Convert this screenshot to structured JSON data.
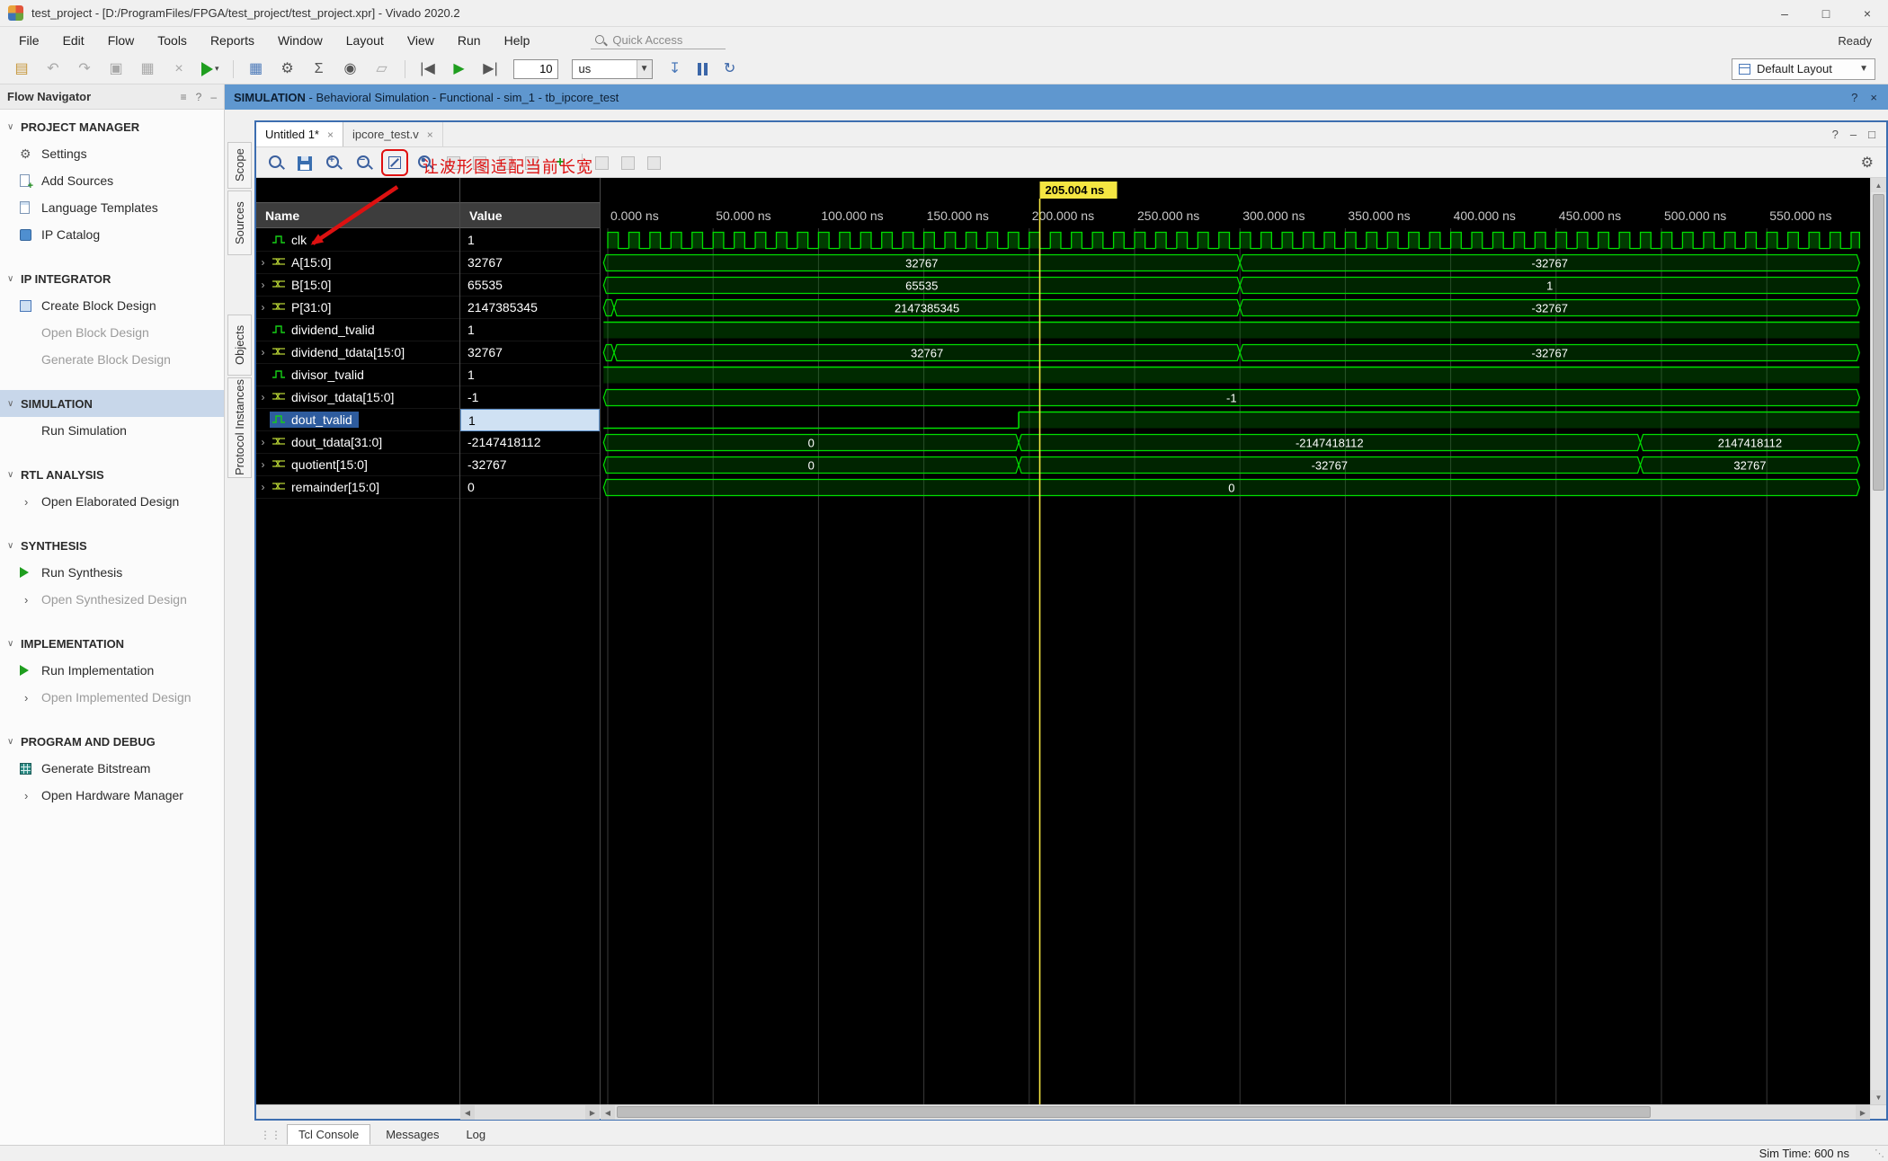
{
  "window": {
    "title": "test_project - [D:/ProgramFiles/FPGA/test_project/test_project.xpr] - Vivado 2020.2",
    "controls": {
      "minimize": "–",
      "maximize": "□",
      "close": "×"
    }
  },
  "menu": {
    "items": [
      "File",
      "Edit",
      "Flow",
      "Tools",
      "Reports",
      "Window",
      "Layout",
      "View",
      "Run",
      "Help"
    ],
    "quick_access": "Quick Access",
    "ready": "Ready"
  },
  "toolbar": {
    "time_value": "10",
    "time_unit": "us",
    "layout_label": "Default Layout"
  },
  "context_bar": {
    "title": "SIMULATION",
    "subtitle": " - Behavioral Simulation - Functional - sim_1 - tb_ipcore_test"
  },
  "flow_navigator": {
    "title": "Flow Navigator",
    "sections": [
      {
        "label": "PROJECT MANAGER",
        "selected": false,
        "items": [
          {
            "label": "Settings",
            "icon": "gear",
            "enabled": true,
            "chevron": false
          },
          {
            "label": "Add Sources",
            "icon": "docplus",
            "enabled": true,
            "chevron": false
          },
          {
            "label": "Language Templates",
            "icon": "doc",
            "enabled": true,
            "chevron": false
          },
          {
            "label": "IP Catalog",
            "icon": "ip",
            "enabled": true,
            "chevron": false
          }
        ]
      },
      {
        "label": "IP INTEGRATOR",
        "selected": false,
        "items": [
          {
            "label": "Create Block Design",
            "icon": "block",
            "enabled": true,
            "chevron": false
          },
          {
            "label": "Open Block Design",
            "icon": "none",
            "enabled": false,
            "chevron": false
          },
          {
            "label": "Generate Block Design",
            "icon": "none",
            "enabled": false,
            "chevron": false
          }
        ]
      },
      {
        "label": "SIMULATION",
        "selected": true,
        "items": [
          {
            "label": "Run Simulation",
            "icon": "none",
            "enabled": true,
            "chevron": false
          }
        ]
      },
      {
        "label": "RTL ANALYSIS",
        "selected": false,
        "items": [
          {
            "label": "Open Elaborated Design",
            "icon": "none",
            "enabled": true,
            "chevron": true
          }
        ]
      },
      {
        "label": "SYNTHESIS",
        "selected": false,
        "items": [
          {
            "label": "Run Synthesis",
            "icon": "play",
            "enabled": true,
            "chevron": false
          },
          {
            "label": "Open Synthesized Design",
            "icon": "none",
            "enabled": false,
            "chevron": true
          }
        ]
      },
      {
        "label": "IMPLEMENTATION",
        "selected": false,
        "items": [
          {
            "label": "Run Implementation",
            "icon": "play",
            "enabled": true,
            "chevron": false
          },
          {
            "label": "Open Implemented Design",
            "icon": "none",
            "enabled": false,
            "chevron": true
          }
        ]
      },
      {
        "label": "PROGRAM AND DEBUG",
        "selected": false,
        "items": [
          {
            "label": "Generate Bitstream",
            "icon": "bitstream",
            "enabled": true,
            "chevron": false
          },
          {
            "label": "Open Hardware Manager",
            "icon": "none",
            "enabled": true,
            "chevron": true
          }
        ]
      }
    ]
  },
  "side_tabs": [
    {
      "label": "Scope"
    },
    {
      "label": "Sources"
    },
    {
      "label": "Objects"
    },
    {
      "label": "Protocol Instances"
    }
  ],
  "wave_panel": {
    "tabs": [
      {
        "label": "Untitled 1*",
        "active": true
      },
      {
        "label": "ipcore_test.v",
        "active": false
      }
    ],
    "annotation_text": "让波形图适配当前长宽",
    "columns": {
      "name": "Name",
      "value": "Value"
    },
    "cursor": {
      "t": 205.004,
      "label": "205.004 ns"
    },
    "t_end": 594,
    "timeline": [
      {
        "t": 0,
        "label": "0.000 ns"
      },
      {
        "t": 50,
        "label": "50.000 ns"
      },
      {
        "t": 100,
        "label": "100.000 ns"
      },
      {
        "t": 150,
        "label": "150.000 ns"
      },
      {
        "t": 200,
        "label": "200.000 ns"
      },
      {
        "t": 250,
        "label": "250.000 ns"
      },
      {
        "t": 300,
        "label": "300.000 ns"
      },
      {
        "t": 350,
        "label": "350.000 ns"
      },
      {
        "t": 400,
        "label": "400.000 ns"
      },
      {
        "t": 450,
        "label": "450.000 ns"
      },
      {
        "t": 500,
        "label": "500.000 ns"
      },
      {
        "t": 550,
        "label": "550.000 ns"
      }
    ],
    "signals": [
      {
        "name": "clk",
        "value": "1",
        "kind": "clock",
        "period": 10
      },
      {
        "name": "A[15:0]",
        "value": "32767",
        "kind": "bus",
        "segs": [
          {
            "t0": -2,
            "t1": 300,
            "label": "32767"
          },
          {
            "t0": 300,
            "t1": 594,
            "label": "-32767"
          }
        ]
      },
      {
        "name": "B[15:0]",
        "value": "65535",
        "kind": "bus",
        "segs": [
          {
            "t0": -2,
            "t1": 300,
            "label": "65535"
          },
          {
            "t0": 300,
            "t1": 594,
            "label": "1"
          }
        ]
      },
      {
        "name": "P[31:0]",
        "value": "2147385345",
        "kind": "bus",
        "segs": [
          {
            "t0": -2,
            "t1": 3,
            "label": ""
          },
          {
            "t0": 3,
            "t1": 300,
            "label": "2147385345"
          },
          {
            "t0": 300,
            "t1": 594,
            "label": "-32767"
          }
        ]
      },
      {
        "name": "dividend_tvalid",
        "value": "1",
        "kind": "bit",
        "segs": [
          {
            "t0": -2,
            "t1": 594,
            "level": 1
          }
        ]
      },
      {
        "name": "dividend_tdata[15:0]",
        "value": "32767",
        "kind": "bus",
        "segs": [
          {
            "t0": -2,
            "t1": 3,
            "label": ""
          },
          {
            "t0": 3,
            "t1": 300,
            "label": "32767"
          },
          {
            "t0": 300,
            "t1": 594,
            "label": "-32767"
          }
        ]
      },
      {
        "name": "divisor_tvalid",
        "value": "1",
        "kind": "bit",
        "segs": [
          {
            "t0": -2,
            "t1": 594,
            "level": 1
          }
        ]
      },
      {
        "name": "divisor_tdata[15:0]",
        "value": "-1",
        "kind": "bus",
        "segs": [
          {
            "t0": -2,
            "t1": 594,
            "label": "-1"
          }
        ]
      },
      {
        "name": "dout_tvalid",
        "value": "1",
        "kind": "bit",
        "selected": true,
        "segs": [
          {
            "t0": -2,
            "t1": 195,
            "level": 0
          },
          {
            "t0": 195,
            "t1": 594,
            "level": 1
          }
        ]
      },
      {
        "name": "dout_tdata[31:0]",
        "value": "-2147418112",
        "kind": "bus",
        "segs": [
          {
            "t0": -2,
            "t1": 195,
            "label": "0"
          },
          {
            "t0": 195,
            "t1": 490,
            "label": "-2147418112"
          },
          {
            "t0": 490,
            "t1": 594,
            "label": "2147418112"
          }
        ]
      },
      {
        "name": "quotient[15:0]",
        "value": "-32767",
        "kind": "bus",
        "segs": [
          {
            "t0": -2,
            "t1": 195,
            "label": "0"
          },
          {
            "t0": 195,
            "t1": 490,
            "label": "-32767"
          },
          {
            "t0": 490,
            "t1": 594,
            "label": "32767"
          }
        ]
      },
      {
        "name": "remainder[15:0]",
        "value": "0",
        "kind": "bus",
        "segs": [
          {
            "t0": -2,
            "t1": 594,
            "label": "0"
          }
        ]
      }
    ]
  },
  "bottom_tabs": [
    {
      "label": "Tcl Console",
      "active": true
    },
    {
      "label": "Messages",
      "active": false
    },
    {
      "label": "Log",
      "active": false
    }
  ],
  "status_bar": {
    "sim_time": "Sim Time: 600 ns"
  },
  "colors": {
    "wave_green": "#00dd00",
    "cursor_yellow": "#f5e642",
    "annotation_red": "#dd1111",
    "selection_blue": "#2e5c9e",
    "grid_gray": "#3a3a3a"
  }
}
